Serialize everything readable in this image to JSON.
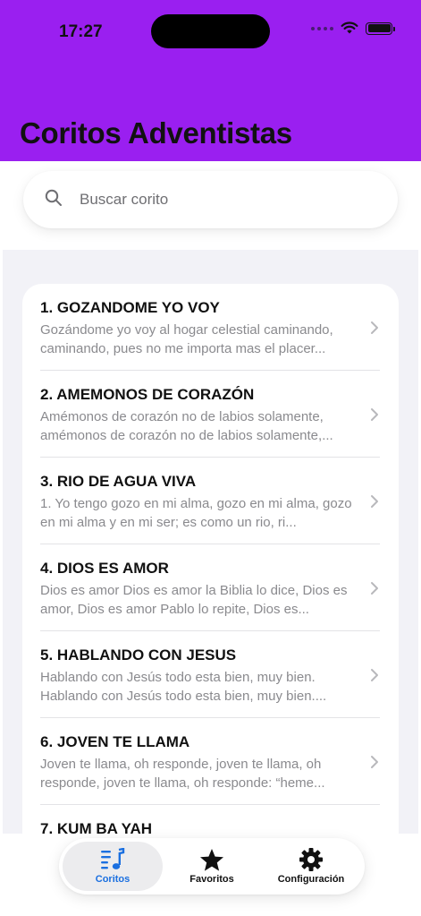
{
  "status_bar": {
    "time": "17:27"
  },
  "header": {
    "title": "Coritos Adventistas",
    "background_color": "#9A1FF0"
  },
  "search": {
    "placeholder": "Buscar corito",
    "value": ""
  },
  "songs": [
    {
      "title": "1. GOZANDOME YO VOY",
      "preview": "Gozándome yo voy al hogar celestial caminando, caminando, pues no me importa mas el placer..."
    },
    {
      "title": "2. AMEMONOS DE CORAZÓN",
      "preview": "Amémonos de corazón no de labios solamente, amémonos de corazón no de labios solamente,..."
    },
    {
      "title": "3. RIO DE AGUA VIVA",
      "preview": "1. Yo tengo gozo en mi alma, gozo en mi alma, gozo en mi alma y en mi ser; es como un rio, ri..."
    },
    {
      "title": "4. DIOS ES AMOR",
      "preview": "Dios es amor Dios es amor la Biblia lo dice, Dios es amor, Dios es amor Pablo lo repite, Dios es..."
    },
    {
      "title": "5. HABLANDO CON JESUS",
      "preview": "Hablando con Jesús todo esta bien, muy bien. Hablando con Jesús todo esta bien, muy bien...."
    },
    {
      "title": "6. JOVEN TE LLAMA",
      "preview": "Joven te llama, oh responde, joven te llama, oh responde, joven te llama, oh responde: “heme..."
    },
    {
      "title": "7. KUM BA YAH",
      "preview": ""
    }
  ],
  "tabbar": {
    "tabs": [
      {
        "label": "Coritos",
        "icon": "music-list-icon",
        "active": true
      },
      {
        "label": "Favoritos",
        "icon": "star-icon",
        "active": false
      },
      {
        "label": "Configuración",
        "icon": "gear-icon",
        "active": false
      }
    ],
    "active_color": "#1A6FE0"
  }
}
